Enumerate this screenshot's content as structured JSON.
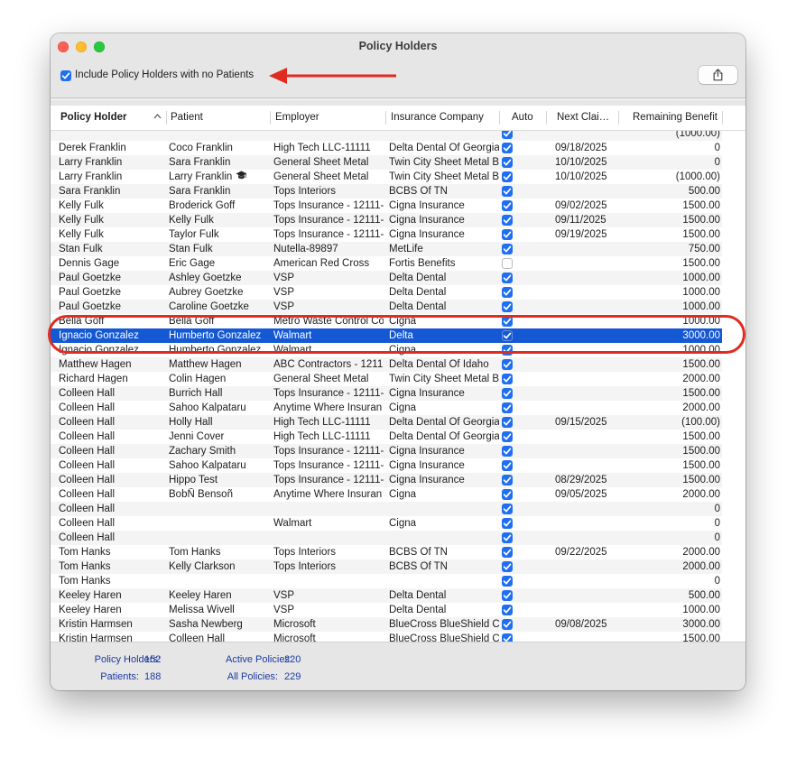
{
  "window": {
    "title": "Policy Holders"
  },
  "toolbar": {
    "include_label": "Include Policy Holders with no Patients",
    "include_checked": true,
    "share_icon": "share-icon"
  },
  "columns": [
    "Policy Holder",
    "Patient",
    "Employer",
    "Insurance Company",
    "Auto",
    "Next Clai…",
    "Remaining Benefit"
  ],
  "rows": [
    {
      "holder": "",
      "patient": "",
      "employer": "",
      "ins": "",
      "auto": true,
      "next": "",
      "rem": "(1000.00)",
      "partial": true
    },
    {
      "holder": "Derek Franklin",
      "patient": "Coco Franklin",
      "employer": "High Tech LLC-11111",
      "ins": "Delta Dental Of Georgia",
      "auto": true,
      "next": "09/18/2025",
      "rem": "0"
    },
    {
      "holder": "Larry Franklin",
      "patient": "Sara Franklin",
      "employer": "General Sheet Metal",
      "ins": "Twin City Sheet Metal B",
      "auto": true,
      "next": "10/10/2025",
      "rem": "0"
    },
    {
      "holder": "Larry Franklin",
      "patient": "Larry Franklin",
      "employer": "General Sheet Metal",
      "ins": "Twin City Sheet Metal B",
      "auto": true,
      "next": "10/10/2025",
      "rem": "(1000.00)",
      "icon": "graduation-cap-icon"
    },
    {
      "holder": "Sara Franklin",
      "patient": "Sara Franklin",
      "employer": "Tops Interiors",
      "ins": "BCBS Of TN",
      "auto": true,
      "next": "",
      "rem": "500.00"
    },
    {
      "holder": "Kelly Fulk",
      "patient": "Broderick Goff",
      "employer": "Tops Insurance - 12111-",
      "ins": "Cigna Insurance",
      "auto": true,
      "next": "09/02/2025",
      "rem": "1500.00"
    },
    {
      "holder": "Kelly Fulk",
      "patient": "Kelly Fulk",
      "employer": "Tops Insurance - 12111-",
      "ins": "Cigna Insurance",
      "auto": true,
      "next": "09/11/2025",
      "rem": "1500.00"
    },
    {
      "holder": "Kelly Fulk",
      "patient": "Taylor Fulk",
      "employer": "Tops Insurance - 12111-",
      "ins": "Cigna Insurance",
      "auto": true,
      "next": "09/19/2025",
      "rem": "1500.00"
    },
    {
      "holder": "Stan Fulk",
      "patient": "Stan Fulk",
      "employer": "Nutella-89897",
      "ins": "MetLife",
      "auto": true,
      "next": "",
      "rem": "750.00"
    },
    {
      "holder": "Dennis Gage",
      "patient": "Eric Gage",
      "employer": "American Red Cross",
      "ins": "Fortis Benefits",
      "auto": false,
      "next": "",
      "rem": "1500.00"
    },
    {
      "holder": "Paul Goetzke",
      "patient": "Ashley Goetzke",
      "employer": "VSP",
      "ins": "Delta Dental",
      "auto": true,
      "next": "",
      "rem": "1000.00"
    },
    {
      "holder": "Paul Goetzke",
      "patient": "Aubrey Goetzke",
      "employer": "VSP",
      "ins": "Delta Dental",
      "auto": true,
      "next": "",
      "rem": "1000.00"
    },
    {
      "holder": "Paul Goetzke",
      "patient": "Caroline Goetzke",
      "employer": "VSP",
      "ins": "Delta Dental",
      "auto": true,
      "next": "",
      "rem": "1000.00"
    },
    {
      "holder": "Bella Goff",
      "patient": "Bella Goff",
      "employer": "Metro Waste Control Co",
      "ins": "Cigna",
      "auto": true,
      "next": "",
      "rem": "1000.00"
    },
    {
      "holder": "Ignacio Gonzalez",
      "patient": "Humberto Gonzalez",
      "employer": "Walmart",
      "ins": "Delta",
      "auto": true,
      "next": "",
      "rem": "3000.00",
      "selected": true
    },
    {
      "holder": "Ignacio Gonzalez",
      "patient": "Humberto Gonzalez",
      "employer": "Walmart",
      "ins": "Cigna",
      "auto": true,
      "next": "",
      "rem": "1000.00"
    },
    {
      "holder": "Matthew Hagen",
      "patient": "Matthew Hagen",
      "employer": "ABC Contractors - 1211",
      "ins": "Delta Dental Of Idaho",
      "auto": true,
      "next": "",
      "rem": "1500.00"
    },
    {
      "holder": "Richard Hagen",
      "patient": "Colin Hagen",
      "employer": "General Sheet Metal",
      "ins": "Twin City Sheet Metal B",
      "auto": true,
      "next": "",
      "rem": "2000.00"
    },
    {
      "holder": "Colleen Hall",
      "patient": "Burrich Hall",
      "employer": "Tops Insurance - 12111-",
      "ins": "Cigna Insurance",
      "auto": true,
      "next": "",
      "rem": "1500.00"
    },
    {
      "holder": "Colleen Hall",
      "patient": "Sahoo Kalpataru",
      "employer": "Anytime Where Insuran",
      "ins": "Cigna",
      "auto": true,
      "next": "",
      "rem": "2000.00"
    },
    {
      "holder": "Colleen Hall",
      "patient": "Holly Hall",
      "employer": "High Tech LLC-11111",
      "ins": "Delta Dental Of Georgia",
      "auto": true,
      "next": "09/15/2025",
      "rem": "(100.00)"
    },
    {
      "holder": "Colleen Hall",
      "patient": "Jenni Cover",
      "employer": "High Tech LLC-11111",
      "ins": "Delta Dental Of Georgia",
      "auto": true,
      "next": "",
      "rem": "1500.00"
    },
    {
      "holder": "Colleen Hall",
      "patient": "Zachary Smith",
      "employer": "Tops Insurance - 12111-",
      "ins": "Cigna Insurance",
      "auto": true,
      "next": "",
      "rem": "1500.00"
    },
    {
      "holder": "Colleen Hall",
      "patient": "Sahoo Kalpataru",
      "employer": "Tops Insurance - 12111-",
      "ins": "Cigna Insurance",
      "auto": true,
      "next": "",
      "rem": "1500.00"
    },
    {
      "holder": "Colleen Hall",
      "patient": "Hippo Test",
      "employer": "Tops Insurance - 12111-",
      "ins": "Cigna Insurance",
      "auto": true,
      "next": "08/29/2025",
      "rem": "1500.00"
    },
    {
      "holder": "Colleen Hall",
      "patient": "BobÑ Bensoñ",
      "employer": "Anytime Where Insuran",
      "ins": "Cigna",
      "auto": true,
      "next": "09/05/2025",
      "rem": "2000.00"
    },
    {
      "holder": "Colleen Hall",
      "patient": "",
      "employer": "",
      "ins": "",
      "auto": true,
      "next": "",
      "rem": "0"
    },
    {
      "holder": "Colleen Hall",
      "patient": "",
      "employer": "Walmart",
      "ins": "Cigna",
      "auto": true,
      "next": "",
      "rem": "0"
    },
    {
      "holder": "Colleen Hall",
      "patient": "",
      "employer": "",
      "ins": "",
      "auto": true,
      "next": "",
      "rem": "0"
    },
    {
      "holder": "Tom Hanks",
      "patient": "Tom Hanks",
      "employer": "Tops Interiors",
      "ins": "BCBS Of TN",
      "auto": true,
      "next": "09/22/2025",
      "rem": "2000.00"
    },
    {
      "holder": "Tom Hanks",
      "patient": "Kelly Clarkson",
      "employer": "Tops Interiors",
      "ins": "BCBS Of TN",
      "auto": true,
      "next": "",
      "rem": "2000.00"
    },
    {
      "holder": "Tom Hanks",
      "patient": "",
      "employer": "",
      "ins": "",
      "auto": true,
      "next": "",
      "rem": "0"
    },
    {
      "holder": "Keeley Haren",
      "patient": "Keeley Haren",
      "employer": "VSP",
      "ins": "Delta Dental",
      "auto": true,
      "next": "",
      "rem": "500.00"
    },
    {
      "holder": "Keeley Haren",
      "patient": "Melissa Wivell",
      "employer": "VSP",
      "ins": "Delta Dental",
      "auto": true,
      "next": "",
      "rem": "1000.00"
    },
    {
      "holder": "Kristin Harmsen",
      "patient": "Sasha Newberg",
      "employer": "Microsoft",
      "ins": "BlueCross BlueShield C",
      "auto": true,
      "next": "09/08/2025",
      "rem": "3000.00"
    },
    {
      "holder": "Kristin Harmsen",
      "patient": "Colleen Hall",
      "employer": "Microsoft",
      "ins": "BlueCross BlueShield C",
      "auto": true,
      "next": "",
      "rem": "1500.00"
    }
  ],
  "footer": {
    "policy_holders_label": "Policy Holders:",
    "policy_holders": "152",
    "patients_label": "Patients:",
    "patients": "188",
    "active_policies_label": "Active Policies:",
    "active_policies": "220",
    "all_policies_label": "All Policies:",
    "all_policies": "229"
  },
  "colors": {
    "selection": "#1458d4",
    "checkbox": "#1f6ff0",
    "annotation": "#e02b20",
    "footer_text": "#1c3aa0"
  }
}
